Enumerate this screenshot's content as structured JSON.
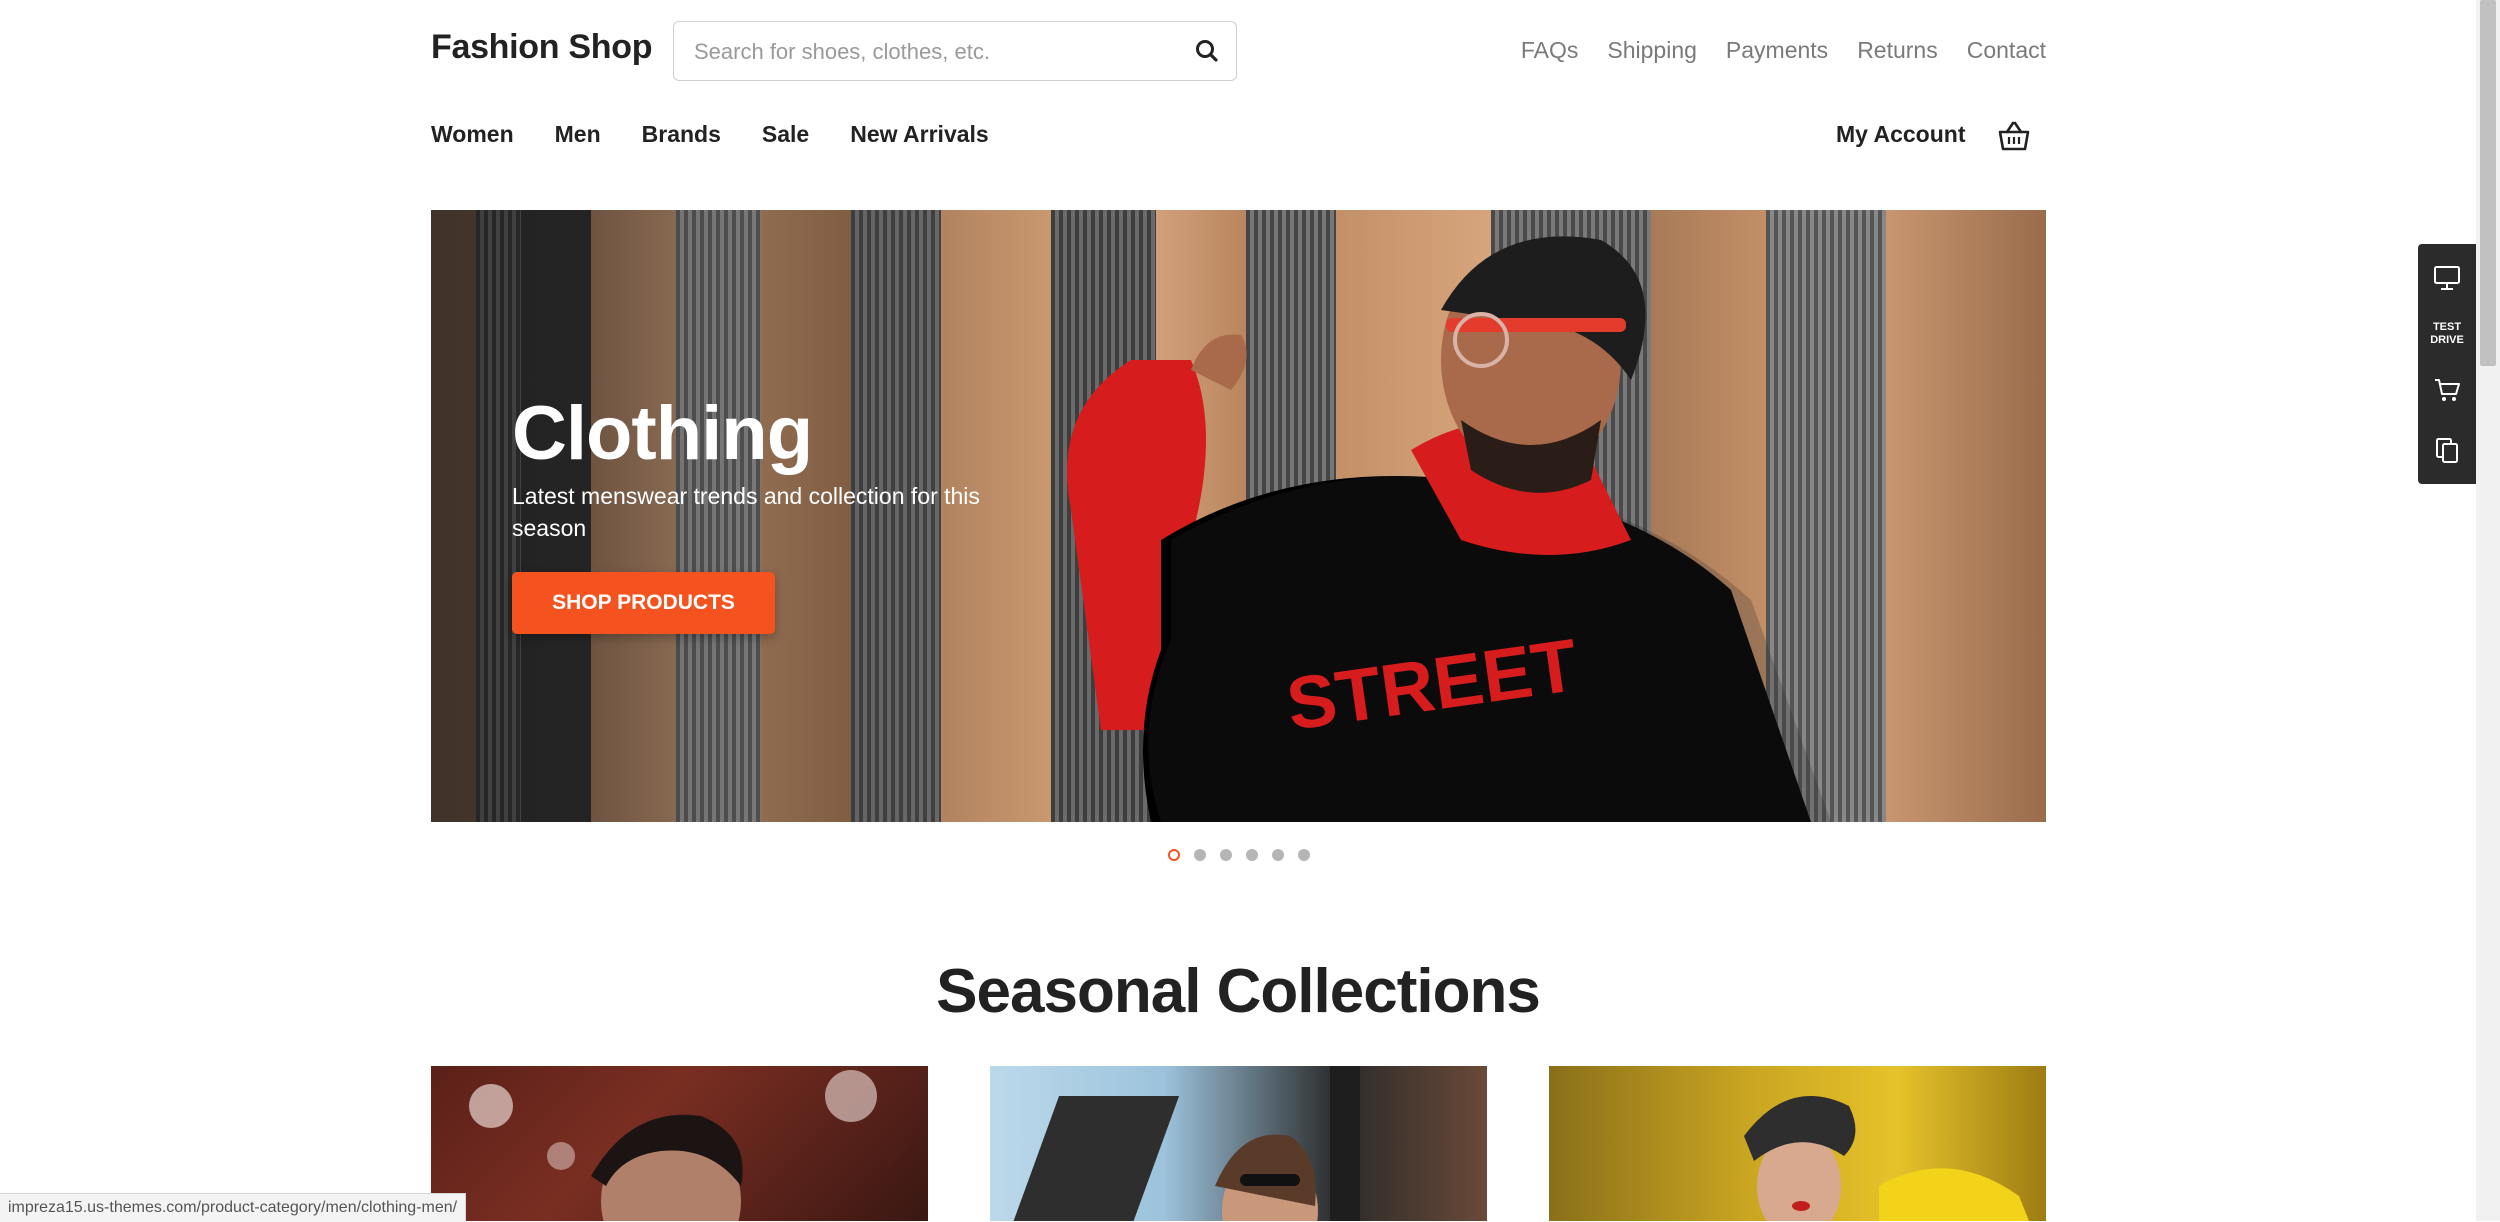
{
  "header": {
    "logo": "Fashion Shop",
    "search_placeholder": "Search for shoes, clothes, etc.",
    "search_icon": "search-icon",
    "top_links": [
      "FAQs",
      "Shipping",
      "Payments",
      "Returns",
      "Contact"
    ]
  },
  "nav": {
    "items": [
      "Women",
      "Men",
      "Brands",
      "Sale",
      "New Arrivals"
    ],
    "account": "My Account",
    "cart_icon": "basket-icon"
  },
  "hero": {
    "title": "Clothing",
    "subtitle": "Latest menswear trends and collection for this season",
    "button": "SHOP PRODUCTS",
    "slide_count": 6,
    "active_slide": 1
  },
  "section": {
    "title": "Seasonal Collections"
  },
  "side_panel": {
    "test_drive": "TEST DRIVE",
    "icons": [
      "monitor-icon",
      "cart-icon",
      "copy-icon"
    ]
  },
  "status_url": "impreza15.us-themes.com/product-category/men/clothing-men/",
  "colors": {
    "accent": "#f4531f",
    "text": "#222222",
    "muted": "#7a7a7a",
    "panel": "#2b2b2b"
  }
}
